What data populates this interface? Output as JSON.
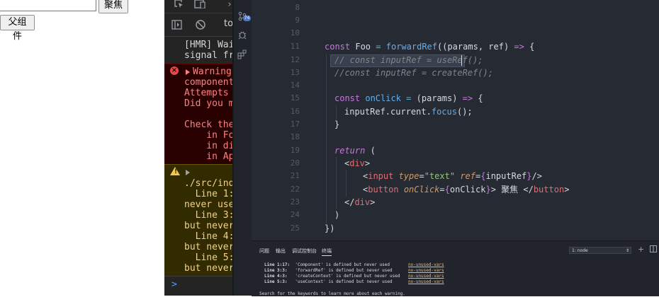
{
  "page": {
    "input_value": "",
    "focus_button_label": "聚焦",
    "parent_button_label": "父组件"
  },
  "console": {
    "hmr_lines": [
      "[HMR] Wai",
      "signal fr"
    ],
    "error_lines": [
      "Warning",
      "component",
      "Attempts",
      "Did you m",
      "",
      "Check the",
      "    in Fo",
      "    in di",
      "    in Ap"
    ],
    "warning_lines": [
      "./src/ind",
      "  Line 1:",
      "never use",
      "  Line 3:",
      "but never",
      "  Line 4:",
      "but never",
      "  Line 5:",
      "but never"
    ],
    "toolbar_partial_label": "to",
    "prompt_symbol": ">"
  },
  "editor": {
    "line_numbers": [
      "8",
      "9",
      "10",
      "11",
      "12",
      "13",
      "14",
      "15",
      "16",
      "17",
      "18",
      "19",
      "20",
      "21",
      "22",
      "23",
      "24",
      "25"
    ],
    "code": {
      "l11": {
        "kw": "const",
        "name": "Foo",
        "eq": "=",
        "fn": "forwardRef",
        "rest_open": "((",
        "params": "params",
        "comma": ", ",
        "ref": "ref",
        "close": ") ",
        "arrow": "=>",
        "brace": " {"
      },
      "l12": "// const inputRef = useRef();",
      "l13": "//const inputRef = createRef();",
      "l15": {
        "kw": "const",
        "name": "onClick",
        "eq": "=",
        "params": "(params)",
        "arrow": "=>",
        "brace": "{"
      },
      "l16": {
        "obj": "inputRef",
        "prop": "current",
        "fn": "focus",
        "tail": "();"
      },
      "l17": "}",
      "l19": {
        "kw": "return",
        "paren": "("
      },
      "l20": {
        "open": "<",
        "tag": "div",
        "close": ">"
      },
      "l21": {
        "open": "<",
        "tag": "input",
        "a1": "type",
        "v1": "\"text\"",
        "a2": "ref",
        "v2_open": "{",
        "v2": "inputRef",
        "v2_close": "}",
        "end": "/>"
      },
      "l22": {
        "open": "<",
        "tag": "button",
        "a1": "onClick",
        "v1_open": "{",
        "v1": "onClick",
        "v1_close": "}",
        "gt": ">",
        "text": " 聚焦 ",
        "close_open": "</",
        "close_tag": "button",
        "close_gt": ">"
      },
      "l23": {
        "open": "</",
        "tag": "div",
        "close": ">"
      },
      "l24": ")",
      "l25": "})"
    }
  },
  "activity_bar": {
    "badge": "74"
  },
  "panel": {
    "tabs": [
      "问题",
      "输出",
      "调试控制台",
      "终端"
    ],
    "terminal_select": "1: node",
    "lines": [
      {
        "loc": "Line 1:17:",
        "msg": "'Component' is defined but never used",
        "rule": "no-unused-vars"
      },
      {
        "loc": "Line 3:3:",
        "msg": "'forwardRef' is defined but never used",
        "rule": "no-unused-vars"
      },
      {
        "loc": "Line 4:3:",
        "msg": "'createContext' is defined but never used",
        "rule": "no-unused-vars"
      },
      {
        "loc": "Line 5:3:",
        "msg": "'useContext' is defined but never used",
        "rule": "no-unused-vars"
      }
    ],
    "footer": "Search for the keywords to learn more about each warning."
  },
  "colors": {
    "editor_bg": "#262a33",
    "console_error_bg": "#290000",
    "console_warning_bg": "#332b00",
    "keyword": "#c678dd",
    "function": "#61afef",
    "string": "#98c379",
    "comment": "#7f848e"
  },
  "icons": [
    "inspect-icon",
    "device-toolbar-icon",
    "sidebar-toggle-icon",
    "clear-console-icon",
    "source-control-icon",
    "debug-icon",
    "extensions-icon",
    "error-icon",
    "warning-icon",
    "plus-icon",
    "split-icon"
  ]
}
